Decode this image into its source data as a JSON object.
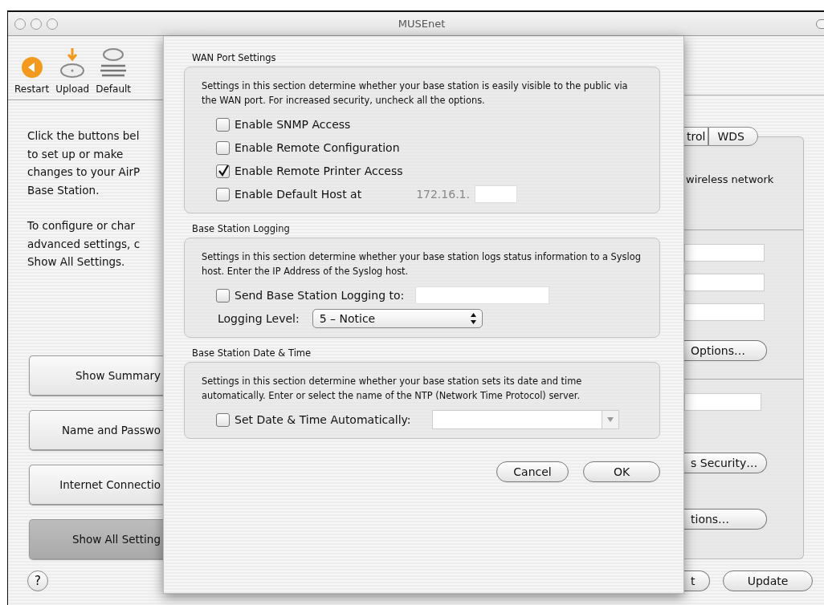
{
  "window": {
    "title": "MUSEnet"
  },
  "toolbar": [
    {
      "label": "Restart",
      "kind": "restart"
    },
    {
      "label": "Upload",
      "kind": "upload"
    },
    {
      "label": "Default",
      "kind": "default"
    }
  ],
  "intro": [
    [
      "Click the buttons bel",
      "to set up or make",
      "changes to your AirP",
      "Base Station."
    ],
    [
      "To configure or char",
      "advanced settings, c",
      "Show All Settings."
    ]
  ],
  "nav_buttons": [
    {
      "label": "Show Summary",
      "selected": false
    },
    {
      "label": "Name and Passwo",
      "selected": false
    },
    {
      "label": "Internet Connectio",
      "selected": false
    },
    {
      "label": "Show All Setting",
      "selected": true
    }
  ],
  "help": "?",
  "sheet": {
    "sections": [
      {
        "title": "WAN Port Settings",
        "description": "Settings in this section determine whether your base station is easily visible to the public via the WAN port. For increased security, uncheck all the options.",
        "controls": [
          {
            "kind": "checkbox",
            "label": "Enable SNMP Access",
            "checked": false
          },
          {
            "kind": "checkbox",
            "label": "Enable Remote Configuration",
            "checked": false
          },
          {
            "kind": "checkbox",
            "label": "Enable Remote Printer Access",
            "checked": true
          },
          {
            "kind": "checkbox-ip",
            "label": "Enable Default Host at",
            "checked": false,
            "prefix": "172.16.1."
          }
        ]
      },
      {
        "title": "Base Station Logging",
        "description": "Settings in this section determine whether your base station logs status information to a Syslog host. Enter the IP Address of the Syslog host.",
        "controls": [
          {
            "kind": "checkbox-field",
            "label": "Send Base Station Logging to:",
            "checked": false
          },
          {
            "kind": "popup",
            "label": "Logging Level:",
            "value": "5 – Notice"
          }
        ]
      },
      {
        "title": "Base Station Date & Time",
        "description": "Settings in this section determine whether your base station sets its date and time automatically. Enter or select the name of the NTP (Network Time Protocol) server.",
        "controls": [
          {
            "kind": "checkbox-combo",
            "label": "Set Date & Time Automatically:",
            "checked": false
          }
        ]
      }
    ],
    "buttons": [
      "Cancel",
      "OK"
    ]
  },
  "right_panel": {
    "tabs": [
      {
        "label": "trol",
        "selected": false
      },
      {
        "label": "WDS",
        "selected": false
      }
    ],
    "description": "wireless network",
    "buttons": [
      "Options…",
      "s Security…",
      "tions…"
    ]
  },
  "footer_buttons": [
    "t",
    "Update"
  ]
}
